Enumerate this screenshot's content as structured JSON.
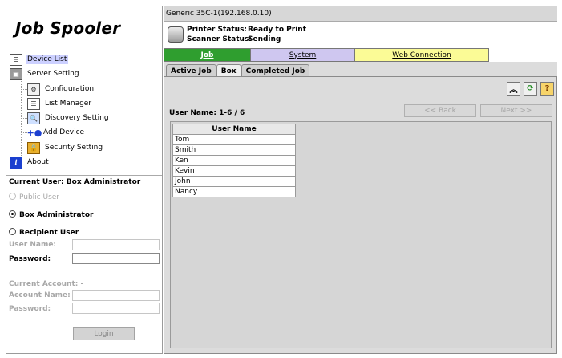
{
  "app": {
    "title": "Job Spooler"
  },
  "nav": {
    "device_list": "Device List",
    "server_setting": "Server Setting",
    "configuration": "Configuration",
    "list_manager": "List Manager",
    "discovery_setting": "Discovery Setting",
    "add_device": "Add Device",
    "security_setting": "Security Setting",
    "about": "About"
  },
  "login": {
    "current_user": "Current User: Box Administrator",
    "public_user": "Public User",
    "box_administrator": "Box Administrator",
    "recipient_user": "Recipient User",
    "user_name_label": "User Name:",
    "password_label": "Password:",
    "current_account": "Current Account: -",
    "account_name_label": "Account Name:",
    "account_password_label": "Password:",
    "login_button": "Login"
  },
  "device": {
    "title": "Generic 35C-1(192.168.0.10)",
    "printer_status_label": "Printer Status:",
    "printer_status": "Ready to Print",
    "scanner_status_label": "Scanner Status:",
    "scanner_status": "Sending"
  },
  "main_tabs": {
    "job": "Job",
    "system": "System",
    "web_connection": "Web Connection"
  },
  "sub_tabs": {
    "active_job": "Active Job",
    "box": "Box",
    "completed_job": "Completed Job"
  },
  "box": {
    "user_count": "User Name: 1-6 / 6",
    "back_button": "<< Back",
    "next_button": "Next >>",
    "column_header": "User Name",
    "users": [
      "Tom",
      "Smith",
      "Ken",
      "Kevin",
      "John",
      "Nancy"
    ]
  },
  "icons": {
    "up": "double-chevron-up-icon",
    "refresh": "refresh-icon",
    "help": "help-icon"
  },
  "colors": {
    "job_tab": "#2f9e2f",
    "system_tab": "#cfc7f0",
    "web_tab": "#fbfb96",
    "selected_nav": "#ccd0ff"
  }
}
